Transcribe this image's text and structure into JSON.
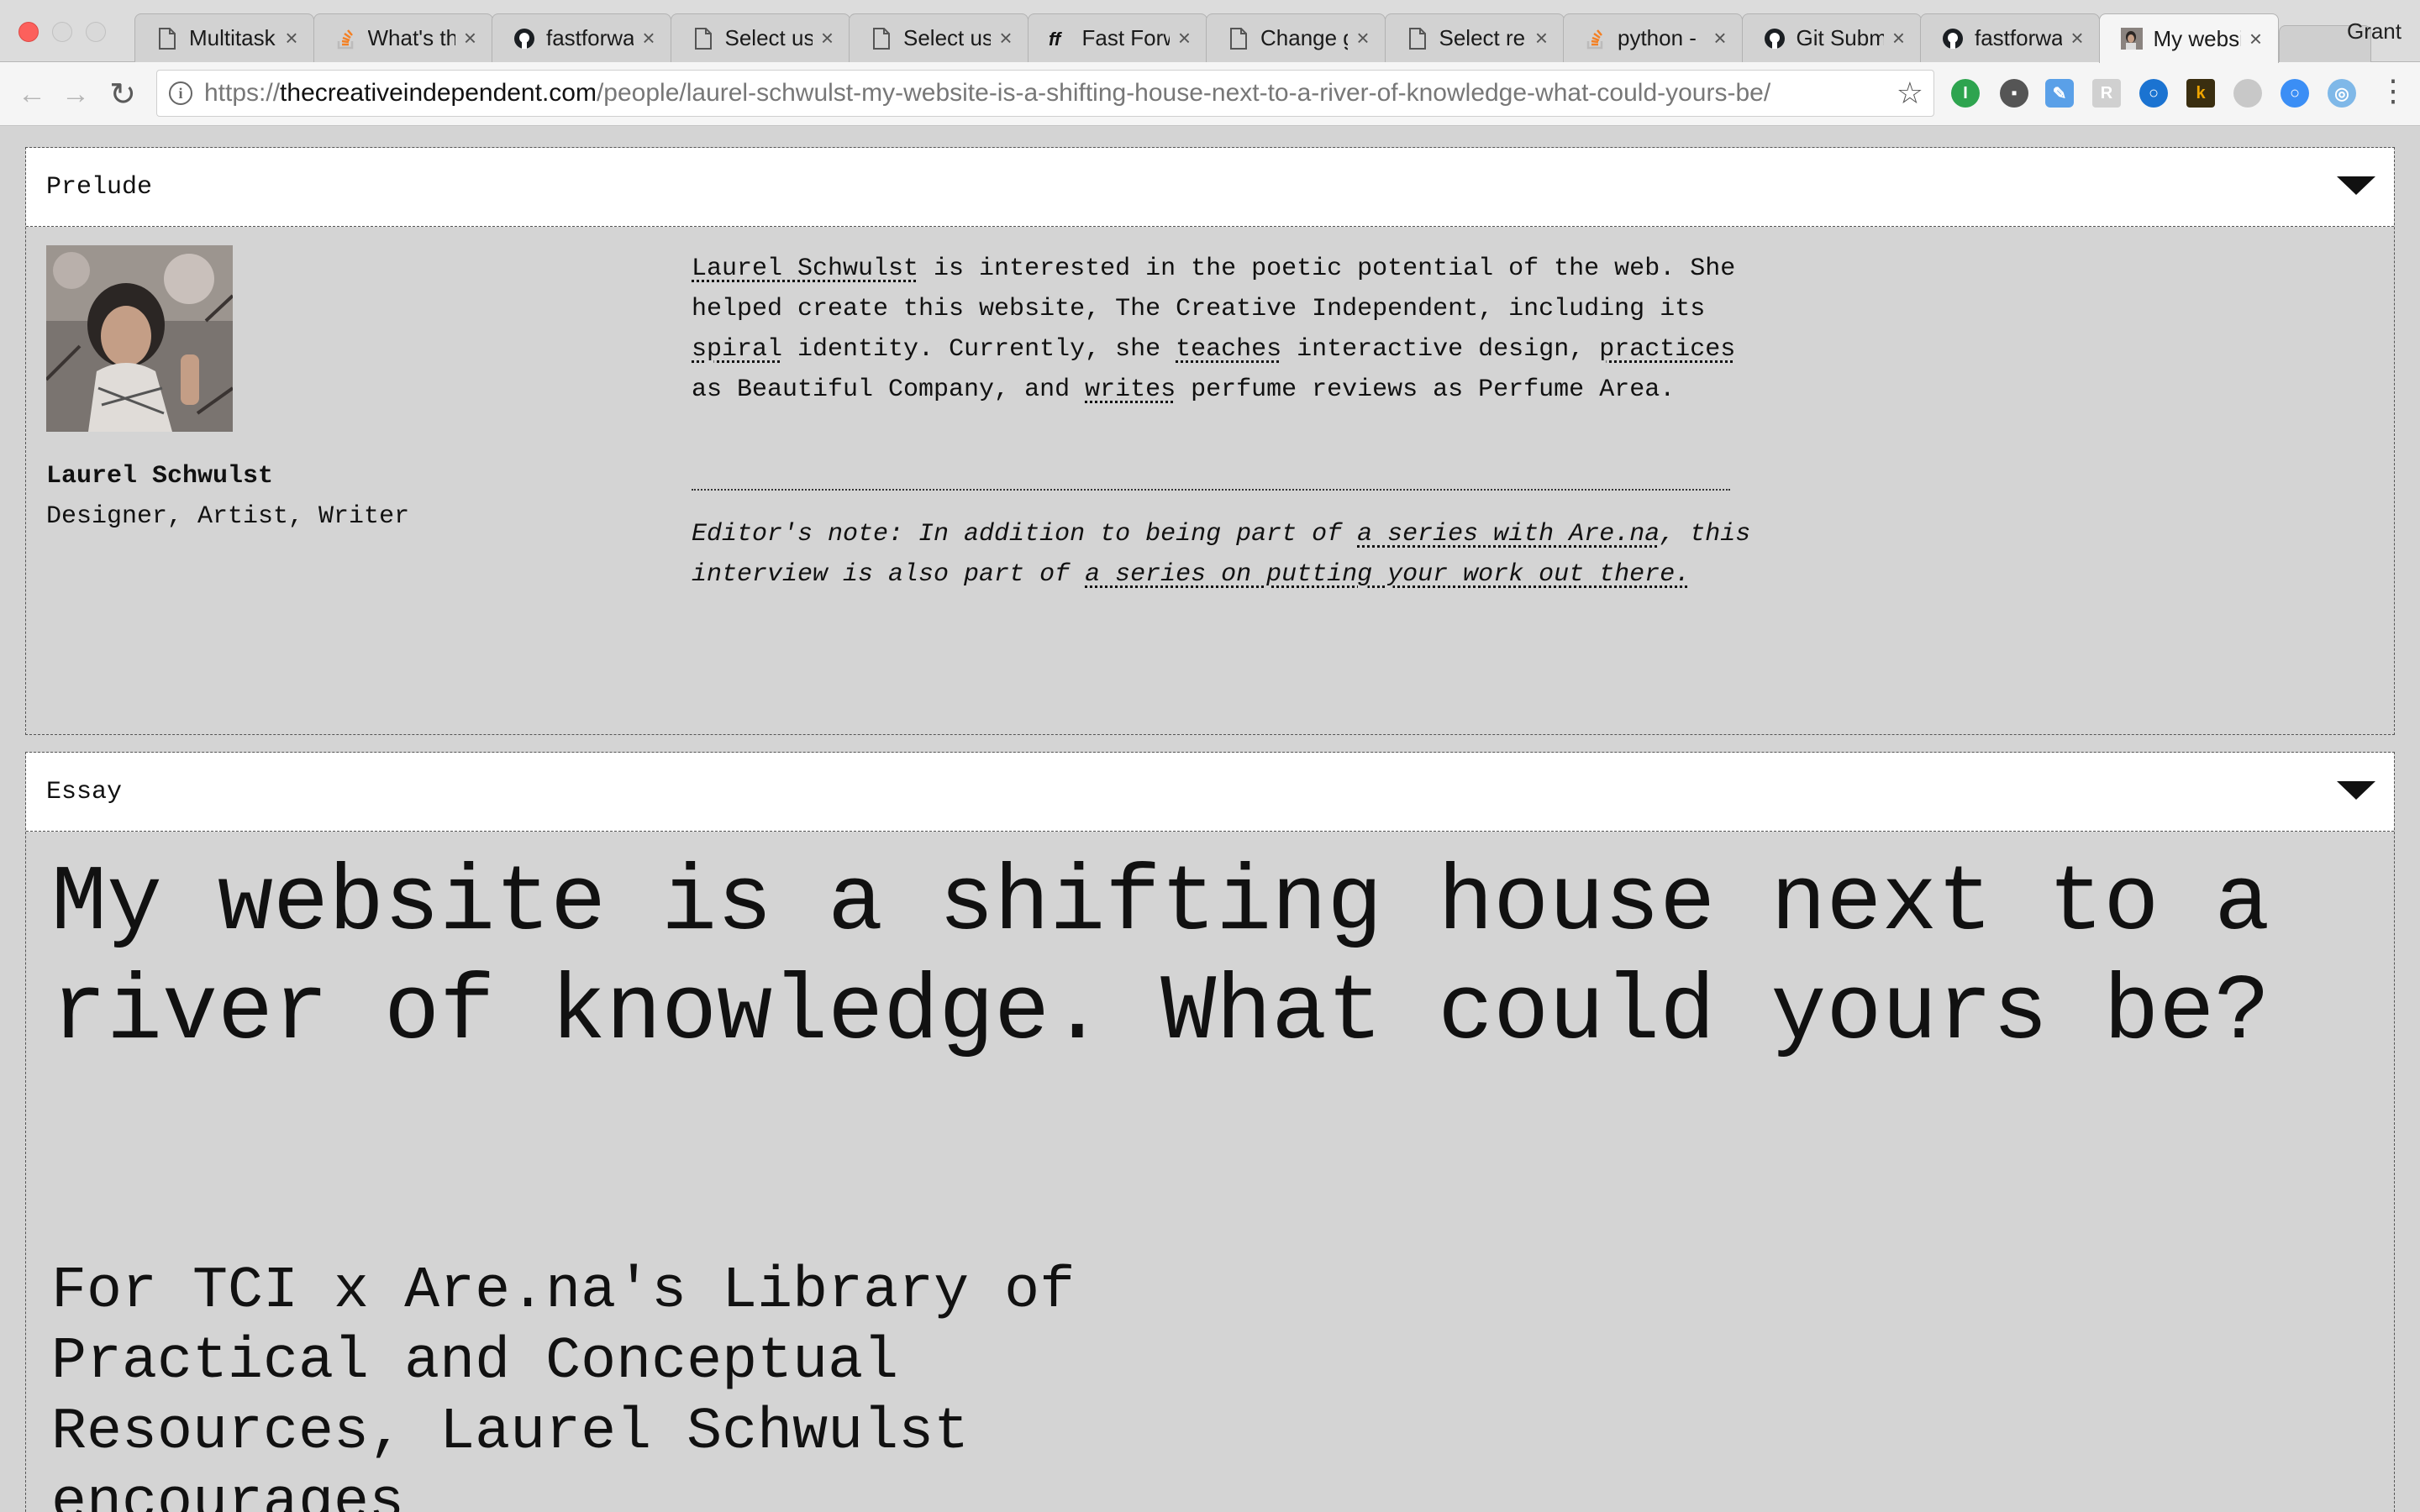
{
  "browser": {
    "tabs": [
      {
        "label": "Multitask",
        "icon": "document-icon"
      },
      {
        "label": "What's th",
        "icon": "stackoverflow-icon"
      },
      {
        "label": "fastforwa",
        "icon": "github-icon"
      },
      {
        "label": "Select us",
        "icon": "document-icon"
      },
      {
        "label": "Select us",
        "icon": "document-icon"
      },
      {
        "label": "Fast Forw",
        "icon": "ff-logo-icon"
      },
      {
        "label": "Change g",
        "icon": "document-icon"
      },
      {
        "label": "Select re",
        "icon": "document-icon"
      },
      {
        "label": "python -",
        "icon": "stackoverflow-icon"
      },
      {
        "label": "Git Subm",
        "icon": "github-icon"
      },
      {
        "label": "fastforwa",
        "icon": "github-icon"
      },
      {
        "label": "My websi",
        "icon": "portrait-favicon"
      }
    ],
    "tab_close": "×",
    "profile_name": "Grant",
    "url_scheme": "https://",
    "url_domain": "thecreativeindependent.com",
    "url_path": "/people/laurel-schwulst-my-website-is-a-shifting-house-next-to-a-river-of-knowledge-what-could-yours-be/",
    "nav": {
      "back": "←",
      "forward": "→",
      "reload": "↻",
      "star": "☆",
      "menu": "⋮",
      "info": "i"
    }
  },
  "prelude": {
    "header": "Prelude",
    "author_name": "Laurel Schwulst",
    "author_role": "Designer, Artist, Writer",
    "bio": {
      "link_name": "Laurel Schwulst",
      "t1": " is interested in the poetic potential of the web. She helped create this website, The Creative Independent, including its ",
      "link_spiral": "spiral",
      "t2": " identity. Currently, she ",
      "link_teaches": "teaches",
      "t3": " interactive design, ",
      "link_practices": "practices",
      "t4": " as Beautiful Company, and ",
      "link_writes": "writes",
      "t5": " perfume reviews as Perfume Area."
    },
    "note": {
      "t1": "Editor's note: In addition to being part of ",
      "link_series1": "a series with Are.na",
      "t2": ", this interview is also part of ",
      "link_series2": "a series on putting your work out there."
    }
  },
  "essay": {
    "header": "Essay",
    "title": "My website is a shifting house next to a river of knowledge. What could yours be?",
    "intro": "For TCI x Are.na's Library of Practical and Conceptual Resources, Laurel Schwulst encourages"
  },
  "colors": {
    "page_bg": "#d4d4d4",
    "header_bg": "#ffffff",
    "active_tab": "#f5f5f5"
  }
}
